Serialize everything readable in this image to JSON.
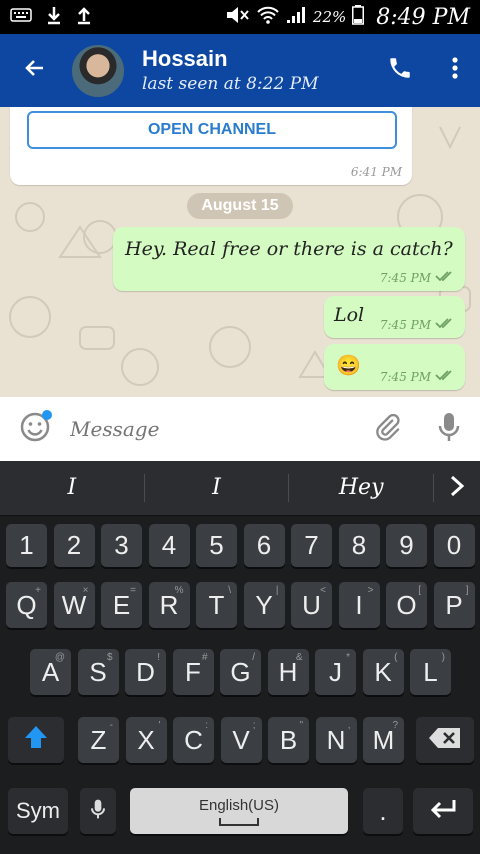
{
  "status_bar": {
    "battery": "22%",
    "time": "8:49 PM"
  },
  "header": {
    "contact_name": "Hossain",
    "last_seen": "last seen at 8:22 PM"
  },
  "chat": {
    "incoming": {
      "button_label": "OPEN CHANNEL",
      "time": "6:41 PM"
    },
    "date_separator": "August 15",
    "outgoing": [
      {
        "text": "Hey. Real free or there is a catch?",
        "time": "7:45 PM",
        "status": "read"
      },
      {
        "text": "Lol",
        "time": "7:45 PM",
        "status": "read"
      },
      {
        "text": "😄",
        "time": "7:45 PM",
        "status": "read"
      }
    ]
  },
  "composer": {
    "placeholder": "Message"
  },
  "keyboard": {
    "suggestions": [
      "I",
      "I",
      "Hey"
    ],
    "number_row": [
      "1",
      "2",
      "3",
      "4",
      "5",
      "6",
      "7",
      "8",
      "9",
      "0"
    ],
    "row1": [
      [
        "Q",
        "+"
      ],
      [
        "W",
        "×"
      ],
      [
        "E",
        "="
      ],
      [
        "R",
        "%"
      ],
      [
        "T",
        "\\"
      ],
      [
        "Y",
        "|"
      ],
      [
        "U",
        "<"
      ],
      [
        "I",
        ">"
      ],
      [
        "O",
        "["
      ],
      [
        "P",
        "]"
      ]
    ],
    "row2": [
      [
        "A",
        "@"
      ],
      [
        "S",
        "$"
      ],
      [
        "D",
        "!"
      ],
      [
        "F",
        "#"
      ],
      [
        "G",
        "/"
      ],
      [
        "H",
        "&"
      ],
      [
        "J",
        "*"
      ],
      [
        "K",
        "("
      ],
      [
        "L",
        ")"
      ]
    ],
    "row3": [
      [
        "Z",
        "-"
      ],
      [
        "X",
        "'"
      ],
      [
        "C",
        ":"
      ],
      [
        "V",
        ";"
      ],
      [
        "B",
        "\""
      ],
      [
        "N",
        ","
      ],
      [
        "M",
        "?"
      ]
    ],
    "sym_label": "Sym",
    "space_label": "English(US)",
    "period_label": "."
  },
  "colors": {
    "header_bg": "#0d47a1",
    "outgoing_bubble": "#d3fbc2",
    "accent_blue": "#2196f3"
  }
}
